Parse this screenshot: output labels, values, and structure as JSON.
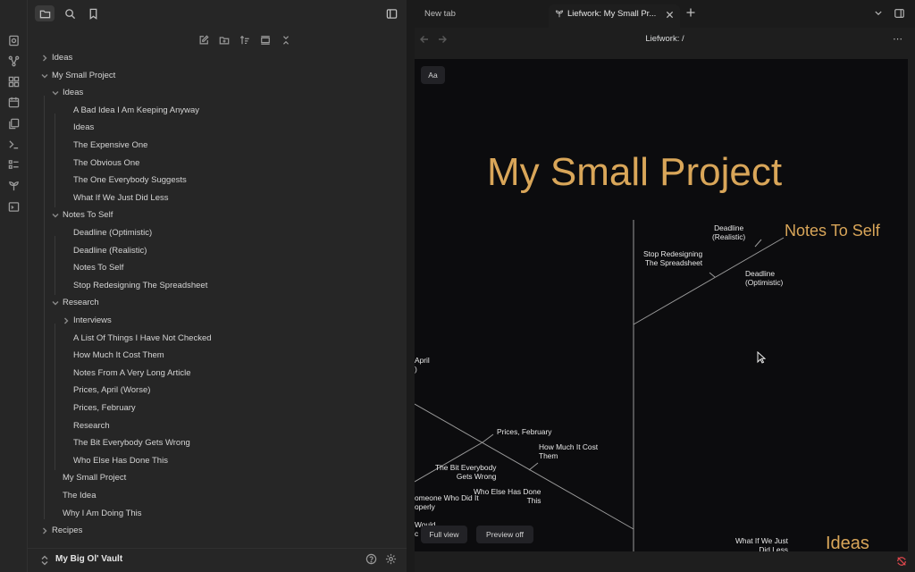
{
  "tabs": [
    {
      "label": "New tab",
      "active": false
    },
    {
      "label": "Liefwork: My Small Pr...",
      "active": true,
      "icon": "sprout-icon"
    }
  ],
  "view": {
    "title": "Liefwork: /"
  },
  "sidebar": {
    "top_buttons": [
      "folder-icon",
      "search-icon",
      "bookmark-icon",
      "sidebar-toggle-icon"
    ],
    "actions": [
      "new-note-icon",
      "new-folder-icon",
      "sort-icon",
      "collapse-panel-icon",
      "collapse-all-icon"
    ],
    "tree": [
      {
        "label": "Ideas",
        "depth": 0,
        "folder": true,
        "open": false
      },
      {
        "label": "My Small Project",
        "depth": 0,
        "folder": true,
        "open": true
      },
      {
        "label": "Ideas",
        "depth": 1,
        "folder": true,
        "open": true
      },
      {
        "label": "A Bad Idea I Am Keeping Anyway",
        "depth": 2
      },
      {
        "label": "Ideas",
        "depth": 2
      },
      {
        "label": "The Expensive One",
        "depth": 2
      },
      {
        "label": "The Obvious One",
        "depth": 2
      },
      {
        "label": "The One Everybody Suggests",
        "depth": 2
      },
      {
        "label": "What If We Just Did Less",
        "depth": 2
      },
      {
        "label": "Notes To Self",
        "depth": 1,
        "folder": true,
        "open": true
      },
      {
        "label": "Deadline (Optimistic)",
        "depth": 2
      },
      {
        "label": "Deadline (Realistic)",
        "depth": 2
      },
      {
        "label": "Notes To Self",
        "depth": 2
      },
      {
        "label": "Stop Redesigning The Spreadsheet",
        "depth": 2
      },
      {
        "label": "Research",
        "depth": 1,
        "folder": true,
        "open": true
      },
      {
        "label": "Interviews",
        "depth": 2,
        "folder": true,
        "open": false
      },
      {
        "label": "A List Of Things I Have Not Checked",
        "depth": 2
      },
      {
        "label": "How Much It Cost Them",
        "depth": 2
      },
      {
        "label": "Notes From A Very Long Article",
        "depth": 2
      },
      {
        "label": "Prices, April (Worse)",
        "depth": 2
      },
      {
        "label": "Prices, February",
        "depth": 2
      },
      {
        "label": "Research",
        "depth": 2
      },
      {
        "label": "The Bit Everybody Gets Wrong",
        "depth": 2
      },
      {
        "label": "Who Else Has Done This",
        "depth": 2
      },
      {
        "label": "My Small Project",
        "depth": 1
      },
      {
        "label": "The Idea",
        "depth": 1
      },
      {
        "label": "Why I Am Doing This",
        "depth": 1
      },
      {
        "label": "Recipes",
        "depth": 0,
        "folder": true,
        "open": false
      }
    ],
    "vault_name": "My Big Ol' Vault"
  },
  "canvas": {
    "font_button": "Aa",
    "root_title": "My Small Project",
    "branch_titles": [
      "Notes To Self",
      "Ideas"
    ],
    "nodes": [
      "Deadline\n(Realistic)",
      "Stop Redesigning\nThe Spreadsheet",
      "Deadline\n(Optimistic)",
      "April\n)",
      "Prices, February",
      "How Much It Cost\nThem",
      "The Bit Everybody\nGets Wrong",
      "omeone Who Did It\noperly",
      "Who Else Has Done\nThis",
      "Would\nc",
      "What If We Just\nDid Less"
    ],
    "full_view_label": "Full view",
    "preview_label": "Preview off"
  },
  "colors": {
    "accent": "#d9a659",
    "sync_error": "#e0484d"
  }
}
